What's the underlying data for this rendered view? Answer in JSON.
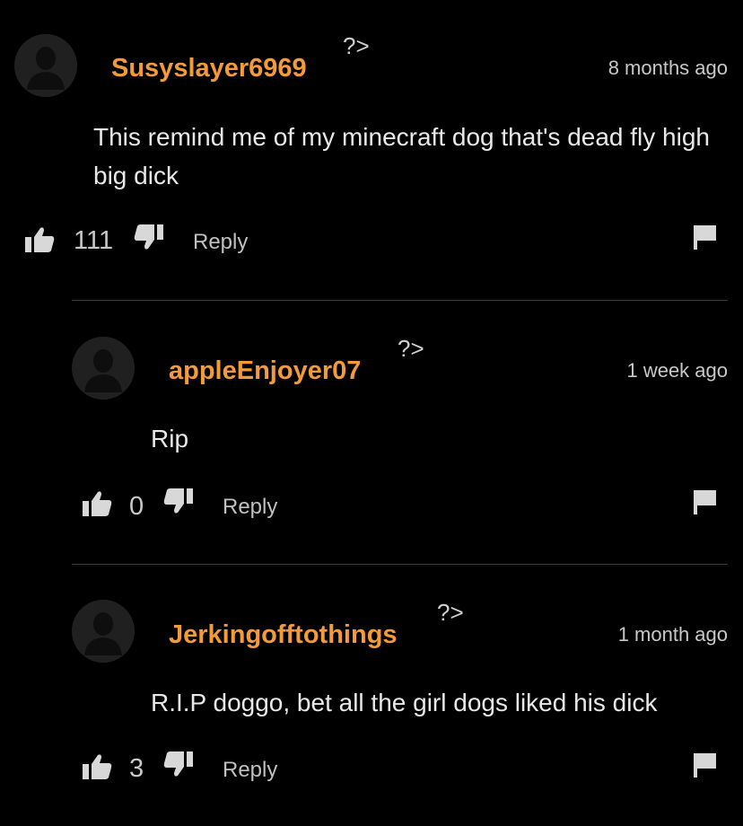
{
  "comments": [
    {
      "username": "Susyslayer6969",
      "badge": "?>",
      "time": "8 months ago",
      "text": "This remind me of my minecraft dog that's dead fly high big dick",
      "likes": "111",
      "reply_label": "Reply"
    },
    {
      "username": "appleEnjoyer07",
      "badge": "?>",
      "time": "1 week ago",
      "text": "Rip",
      "likes": "0",
      "reply_label": "Reply"
    },
    {
      "username": "Jerkingofftothings",
      "badge": "?>",
      "time": "1 month ago",
      "text": "R.I.P doggo, bet all the girl dogs liked his dick",
      "likes": "3",
      "reply_label": "Reply"
    }
  ],
  "colors": {
    "background": "#000000",
    "username": "#f39a3a",
    "text": "#e8e8e8",
    "meta": "#c8c8c8"
  },
  "icons": {
    "avatar": "default-avatar-icon",
    "like": "thumbs-up-icon",
    "dislike": "thumbs-down-icon",
    "report": "flag-icon"
  }
}
